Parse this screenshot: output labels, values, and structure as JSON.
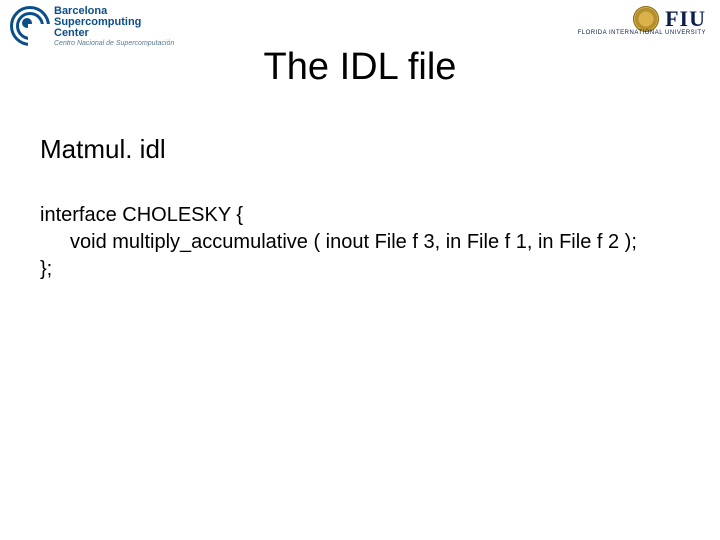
{
  "logos": {
    "bsc": {
      "line1": "Barcelona",
      "line2": "Supercomputing",
      "line3": "Center",
      "subtitle": "Centro Nacional de Supercomputación"
    },
    "fiu": {
      "word": "FIU",
      "subtitle": "FLORIDA INTERNATIONAL UNIVERSITY"
    }
  },
  "title": "The IDL file",
  "filename": "Matmul. idl",
  "code": {
    "line1": "interface CHOLESKY {",
    "line2": "void multiply_accumulative ( inout File f 3, in File f 1, in File f 2 );",
    "line3": "};"
  }
}
